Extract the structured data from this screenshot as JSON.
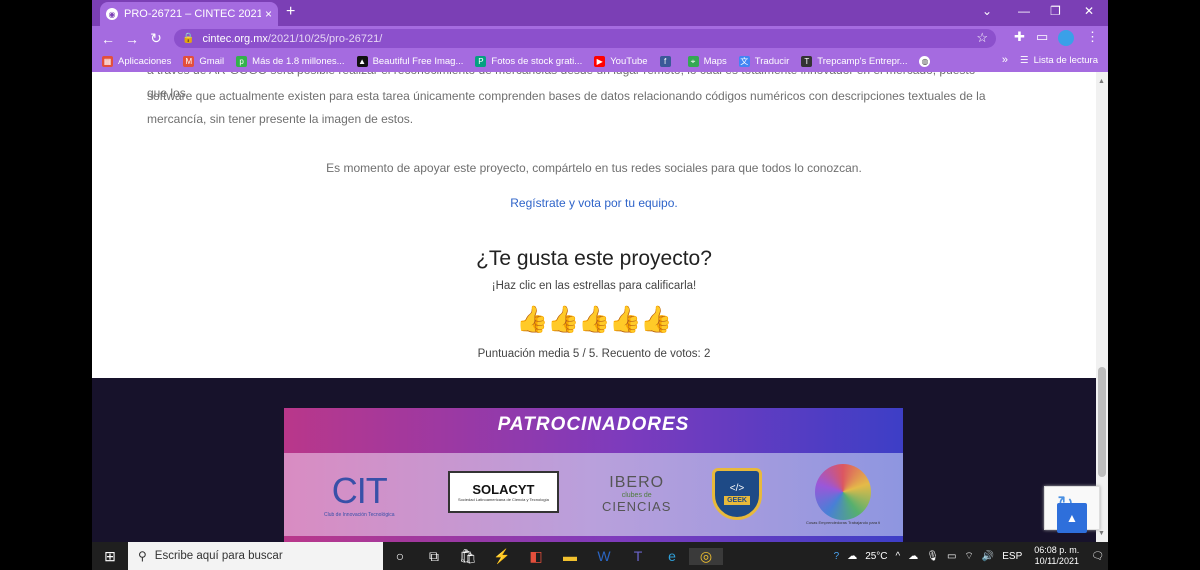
{
  "browser": {
    "tab_title": "PRO-26721 – CINTEC 2021",
    "tab_close": "×",
    "new_tab": "+",
    "url_host": "cintec.org.mx",
    "url_path": "/2021/10/25/pro-26721/",
    "bookmarks": [
      {
        "label": "Aplicaciones",
        "icon": "apps-icon",
        "color": "#e34f3c"
      },
      {
        "label": "Gmail",
        "icon": "gmail-icon",
        "color": "#e34f3c"
      },
      {
        "label": "Más de 1.8 millones...",
        "icon": "px-icon",
        "color": "#33b24c"
      },
      {
        "label": "Beautiful Free Imag...",
        "icon": "unsplash-icon",
        "color": "#111111"
      },
      {
        "label": "Fotos de stock grati...",
        "icon": "pexels-icon",
        "color": "#05a081"
      },
      {
        "label": "YouTube",
        "icon": "youtube-icon",
        "color": "#ff0000"
      },
      {
        "label": "",
        "icon": "facebook-icon",
        "color": "#3b5998"
      },
      {
        "label": "Maps",
        "icon": "maps-icon",
        "color": "#34a853"
      },
      {
        "label": "Traducir",
        "icon": "translate-icon",
        "color": "#4285f4"
      },
      {
        "label": "Trepcamp's Entrepr...",
        "icon": "trepcamp-icon",
        "color": "#333333"
      }
    ],
    "more_bookmarks": "»",
    "reading_list": "Lista de lectura"
  },
  "page": {
    "paragraph_cut": "a través de AR-GOGO será posible realizar el reconocimiento de mercancías desde un lugar remoto, lo cual es totalmente innovador en el mercado, puesto que los",
    "paragraph_line2": "software que actualmente existen para esta tarea únicamente comprenden bases de datos relacionando códigos numéricos con descripciones textuales de la",
    "paragraph_line3": "mercancía, sin tener presente la imagen de estos.",
    "support_text": "Es momento de apoyar este proyecto, compártelo en tus redes sociales para que todos lo conozcan.",
    "register_link": "Regístrate",
    "vote_link": "y vota por tu equipo.",
    "rating_title": "¿Te gusta este proyecto?",
    "rating_subtitle": "¡Haz clic en las estrellas para calificarla!",
    "rating_value": 5,
    "rating_max": 5,
    "rating_summary": "Puntuación media 5 / 5. Recuento de votos: 2",
    "sponsors_title": "PATROCINADORES",
    "sponsors": [
      {
        "name": "CIT",
        "sub": "Club de Innovación Tecnológica"
      },
      {
        "name": "SOLACYT",
        "sub": "Sociedad Latinoamericana de Ciencia y Tecnología"
      },
      {
        "name": "IBERO",
        "sub": "clubes de",
        "name2": "CIENCIAS"
      },
      {
        "name": "GEEK",
        "sub": "</>"
      },
      {
        "name": "Sans Fundación",
        "sub": "Cosas Emprendedoras Trabajando para ti"
      }
    ]
  },
  "taskbar": {
    "search_placeholder": "Escribe aquí para buscar",
    "weather": "25°C",
    "language": "ESP",
    "time": "06:08 p. m.",
    "date": "10/11/2021"
  }
}
